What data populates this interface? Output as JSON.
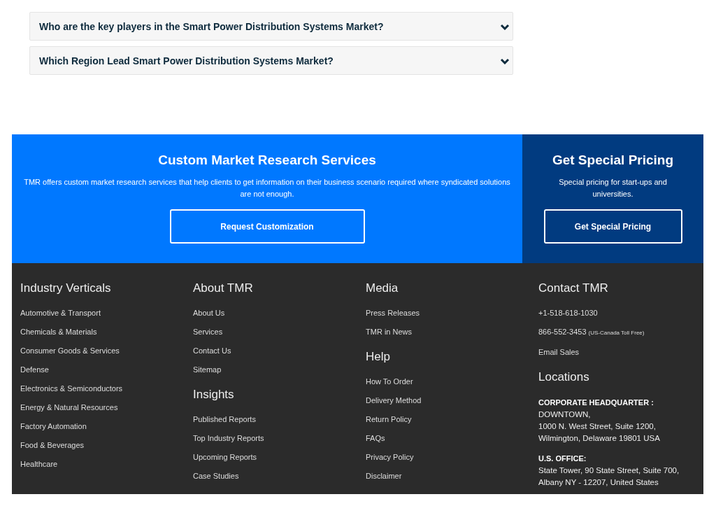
{
  "faq": [
    {
      "question": "Who are the key players in the Smart Power Distribution Systems Market?",
      "expanded": false
    },
    {
      "question": "Which Region Lead Smart Power Distribution Systems Market?",
      "expanded": false
    }
  ],
  "banner": {
    "custom": {
      "title": "Custom Market Research Services",
      "text": "TMR offers custom market research services that help clients to get information on their business scenario required where syndicated solutions are not enough.",
      "button": "Request Customization"
    },
    "pricing": {
      "title": "Get Special Pricing",
      "text": "Special pricing for start-ups and universities.",
      "button": "Get Special Pricing"
    }
  },
  "footer": {
    "columns": [
      {
        "sections": [
          {
            "heading": "Industry Verticals",
            "links": [
              "Automotive & Transport",
              "Chemicals & Materials",
              "Consumer Goods & Services",
              "Defense",
              "Electronics & Semiconductors",
              "Energy & Natural Resources",
              "Factory Automation",
              "Food & Beverages",
              "Healthcare"
            ]
          }
        ]
      },
      {
        "sections": [
          {
            "heading": "About TMR",
            "links": [
              "About Us",
              "Services",
              "Contact Us",
              "Sitemap"
            ]
          },
          {
            "heading": "Insights",
            "links": [
              "Published Reports",
              "Top Industry Reports",
              "Upcoming Reports",
              "Case Studies"
            ]
          }
        ]
      },
      {
        "sections": [
          {
            "heading": "Media",
            "links": [
              "Press Releases",
              "TMR in News"
            ]
          },
          {
            "heading": "Help",
            "links": [
              "How To Order",
              "Delivery Method",
              "Return Policy",
              "FAQs",
              "Privacy Policy",
              "Disclaimer"
            ]
          }
        ]
      }
    ],
    "contact": {
      "heading": "Contact TMR",
      "items": [
        {
          "text": "+1-518-618-1030"
        },
        {
          "text": "866-552-3453",
          "note": "(US-Canada Toll Free)"
        },
        {
          "text": "Email Sales"
        }
      ],
      "locations": {
        "heading": "Locations",
        "offices": [
          {
            "title": "CORPORATE HEADQUARTER :",
            "lines": [
              "DOWNTOWN,",
              "1000 N. West Street, Suite 1200,",
              "Wilmington, Delaware 19801 USA"
            ]
          },
          {
            "title": "U.S. OFFICE:",
            "lines": [
              "State Tower, 90 State Street, Suite 700,",
              "Albany NY - 12207, United States"
            ]
          }
        ]
      }
    }
  }
}
